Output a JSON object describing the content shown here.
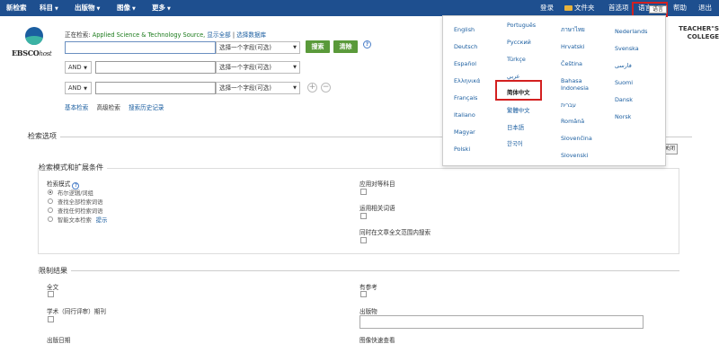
{
  "topnav": {
    "items": [
      "新检索",
      "科目",
      "出版物",
      "图像",
      "更多"
    ],
    "right": {
      "login": "登录",
      "folder": "文件夹",
      "preferences": "首选项",
      "language": "语言",
      "help": "帮助",
      "exit": "退出"
    },
    "language_tooltip": "语言"
  },
  "logo": {
    "ebsco": "EBSCO",
    "host": "host"
  },
  "search": {
    "searching_label": "正在检索:",
    "database": "Applied Science & Technology Source,",
    "show_all": "显示全部",
    "choose_db": "选择数据库",
    "field_select_label": "选择一个字段(可选)",
    "op_label": "AND",
    "search_button": "搜索",
    "clear_button": "清除",
    "help": "?"
  },
  "sublinks": {
    "basic": "基本检索",
    "advanced": "高级检索",
    "history": "搜索历史记录"
  },
  "institution": {
    "line1": "TEACHER\"S",
    "line2": "COLLEGE"
  },
  "close_label": "关闭",
  "options": {
    "title": "检索选项",
    "modes_title": "检索模式和扩展条件",
    "search_mode_label": "检索模式",
    "modes": [
      "布尔逻辑/词组",
      "查找全部检索词语",
      "查找任何检索词语",
      "智能文本检索"
    ],
    "hint_link": "提示",
    "apply_equivalent": "应用对等科目",
    "apply_related": "运用相关词语",
    "also_fulltext": "同时在文章全文范围内搜索",
    "limit_title": "限制结果",
    "full_text": "全文",
    "has_references": "有参考",
    "scholarly": "学术（同行评审）期刊",
    "publication": "出版物",
    "pub_date": "出版日期",
    "image_quick_view": "图像快速查看"
  },
  "languages": {
    "col1": [
      "English",
      "Deutsch",
      "Español",
      "Ελληνικά",
      "Français",
      "Italiano",
      "Magyar",
      "Polski"
    ],
    "col2": [
      "Português",
      "Русский",
      "Türkçe",
      "عربي",
      "简体中文",
      "繁體中文",
      "日本語",
      "한국어"
    ],
    "col3": [
      "ภาษาไทย",
      "Hrvatski",
      "Čeština",
      "Bahasa Indonesia",
      "עברית",
      "Română",
      "Slovenčina",
      "Slovenski"
    ],
    "col4": [
      "Nederlands",
      "Svenska",
      "فارسی",
      "Suomi",
      "Dansk",
      "Norsk"
    ],
    "selected": "简体中文"
  },
  "colors": {
    "topbar": "#1e4f8f",
    "button_green": "#5a9a3a",
    "highlight_red": "#d32020",
    "link_blue": "#1b5ea0"
  }
}
